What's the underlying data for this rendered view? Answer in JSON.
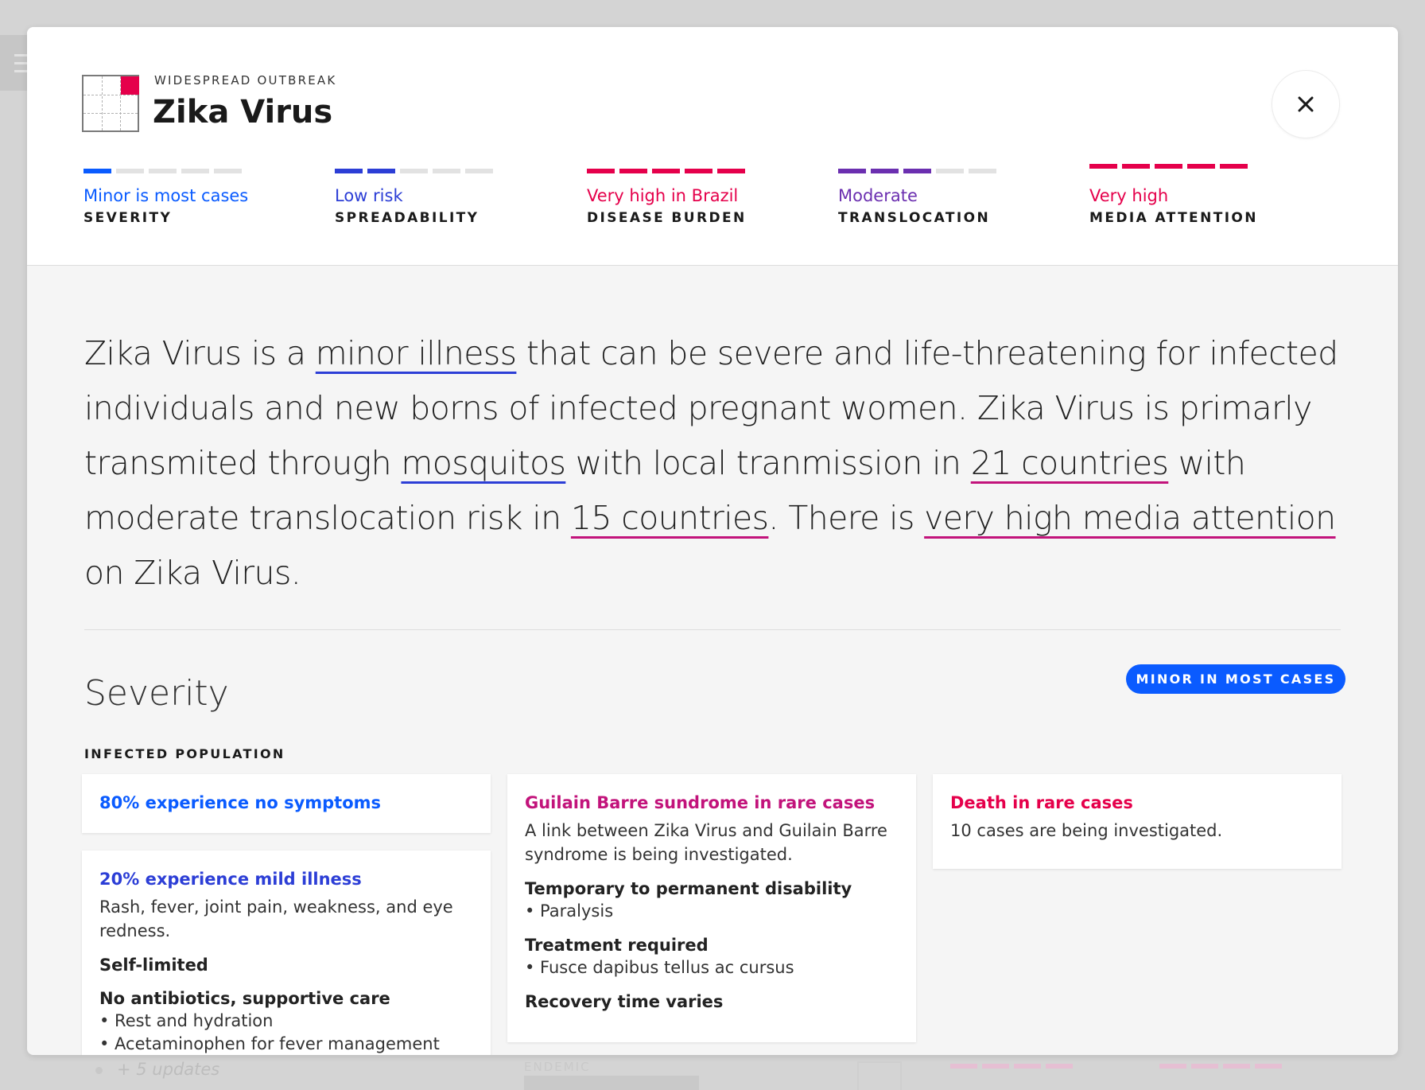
{
  "header": {
    "eyebrow": "WIDESPREAD OUTBREAK",
    "title": "Zika Virus",
    "close_icon": "close-icon"
  },
  "metrics": [
    {
      "value": "Minor is most cases",
      "label": "SEVERITY",
      "level": 1,
      "max": 5,
      "color": "#0a5bff"
    },
    {
      "value": "Low risk",
      "label": "SPREADABILITY",
      "level": 2,
      "max": 5,
      "color": "#2c3ed6"
    },
    {
      "value": "Very high in Brazil",
      "label": "DISEASE BURDEN",
      "level": 5,
      "max": 5,
      "color": "#e5004b"
    },
    {
      "value": "Moderate",
      "label": "TRANSLOCATION",
      "level": 3,
      "max": 5,
      "color": "#6b2fb0"
    },
    {
      "value": "Very high",
      "label": "MEDIA ATTENTION",
      "level": 5,
      "max": 5,
      "color": "#e5004b"
    }
  ],
  "summary": {
    "p1": "Zika Virus is a ",
    "link1": "minor illness",
    "p2": " that can be severe and life-threatening for infected individuals and new borns of infected pregnant women. Zika Virus is primarly transmited through ",
    "link2": "mosquitos",
    "p3": " with local tranmission in ",
    "link3": "21 countries",
    "p4": " with moderate translocation risk in ",
    "link4": "15 countries",
    "p5": ". There is ",
    "link5": "very high media attention",
    "p6": " on Zika Virus."
  },
  "severity": {
    "title": "Severity",
    "badge": "MINOR IN MOST CASES",
    "subhead": "INFECTED POPULATION"
  },
  "cards": {
    "no_symptoms": {
      "title": "80% experience no symptoms"
    },
    "mild": {
      "title": "20% experience mild illness",
      "desc": "Rash, fever, joint pain, weakness, and eye redness.",
      "sub1": "Self-limited",
      "sub2": "No antibiotics, supportive care",
      "item1": "• Rest and hydration",
      "item2": "• Acetaminophen for fever management"
    },
    "guilain": {
      "title": "Guilain Barre sundrome in rare cases",
      "desc": "A link between Zika Virus and Guilain Barre syndrome is being investigated.",
      "sub1": "Temporary to permanent disability",
      "item1": "• Paralysis",
      "sub2": "Treatment required",
      "item2": "• Fusce dapibus tellus ac cursus",
      "sub3": "Recovery time varies"
    },
    "death": {
      "title": "Death in rare cases",
      "desc": "10 cases are being investigated."
    }
  },
  "background": {
    "updates": "+ 5 updates",
    "endemic": "ENDEMIC"
  }
}
